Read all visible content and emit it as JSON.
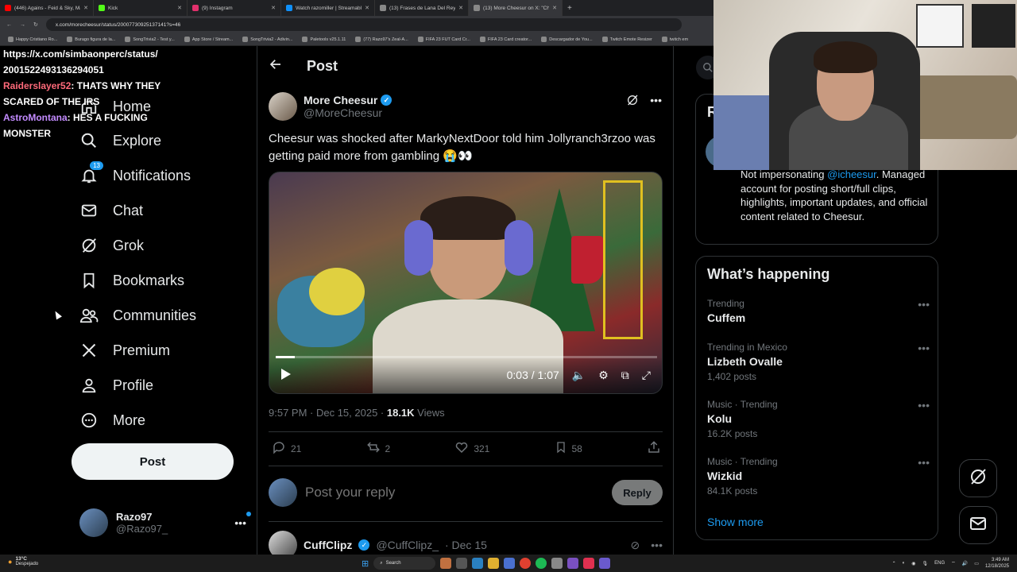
{
  "browser": {
    "tabs": [
      {
        "title": "(446) Agains - Feid & Sky, Majid",
        "color": "#ff0000"
      },
      {
        "title": "Kick",
        "color": "#53fc18"
      },
      {
        "title": "(9) Instagram",
        "color": "#e1306c"
      },
      {
        "title": "Watch razomiller | Streamable",
        "color": "#0f90fa"
      },
      {
        "title": "(13) Frases de Lana Del Rey en",
        "color": "#888888"
      },
      {
        "title": "(13) More Cheesur on X: \"Chees",
        "color": "#888888",
        "active": true
      }
    ],
    "url": "x.com/morecheesur/status/20007730925137141?s=46",
    "bookmarks": [
      "Happy Cristiano Ro...",
      "Burago figura de la...",
      "SongTrivia2 - Test y...",
      "App Store / Stream...",
      "SongTrivia2 - Adivin...",
      "Paletools v25.1.11",
      "(77) Razo97's Zeal-A...",
      "FIFA 23 FUT Card Cr...",
      "FIFA 23 Card creator...",
      "Descargador de You...",
      "Twitch Emote Resizer",
      "twitch em"
    ]
  },
  "chat": {
    "line0": "https://x.com/simbaonperc/status/",
    "line1": "2001522493136294051",
    "m1_user": "Raiderslayer52",
    "m1_text": ": THATS WHY THEY SCARED OF THE IRS",
    "m2_user": "AstroMontana",
    "m2_text": ": HES A FUCKING MONSTER"
  },
  "nav": {
    "home": "Home",
    "explore": "Explore",
    "notifications": "Notifications",
    "notif_badge": "13",
    "chat": "Chat",
    "grok": "Grok",
    "bookmarks": "Bookmarks",
    "communities": "Communities",
    "premium": "Premium",
    "profile": "Profile",
    "more": "More",
    "post": "Post"
  },
  "account": {
    "name": "Razo97",
    "handle": "@Razo97_"
  },
  "main": {
    "title": "Post",
    "author_name": "More Cheesur",
    "author_handle": "@MoreCheesur",
    "text": "Cheesur was shocked after MarkyNextDoor told him Jollyranch3rzoo was getting paid more from gambling 😭👀",
    "video_time": "0:03 / 1:07",
    "video_progress": 0.05,
    "meta_time": "9:57 PM · Dec 15, 2025 · ",
    "meta_views": "18.1K",
    "meta_views_label": " Views",
    "replies": "21",
    "reposts": "2",
    "likes": "321",
    "bookmarks": "58",
    "reply_placeholder": "Post your reply",
    "reply_button": "Reply",
    "second_name": "CuffClipz",
    "second_handle": "@CuffClipz_",
    "second_date": "· Dec 15"
  },
  "right": {
    "card_letter": "R",
    "bio_pre": "Not impersonating ",
    "bio_mention": "@icheesur",
    "bio_post": ". Managed account for posting short/full clips, highlights, important updates, and official content related to Cheesur.",
    "happening_title": "What’s happening",
    "trends": [
      {
        "ctx": "Trending",
        "name": "Cuffem",
        "count": ""
      },
      {
        "ctx": "Trending in Mexico",
        "name": "Lizbeth Ovalle",
        "count": "1,402 posts"
      },
      {
        "ctx": "Music · Trending",
        "name": "Kolu",
        "count": "16.2K posts"
      },
      {
        "ctx": "Music · Trending",
        "name": "Wizkid",
        "count": "84.1K posts"
      }
    ],
    "show_more": "Show more"
  },
  "taskbar": {
    "temp": "13°C",
    "weather": "Despejado",
    "search": "Search",
    "lang": "ENG",
    "time": "3:49 AM",
    "date": "12/18/2025"
  },
  "colors": {
    "accent": "#1d9bf0",
    "bg": "#000000",
    "muted": "#71767b"
  }
}
